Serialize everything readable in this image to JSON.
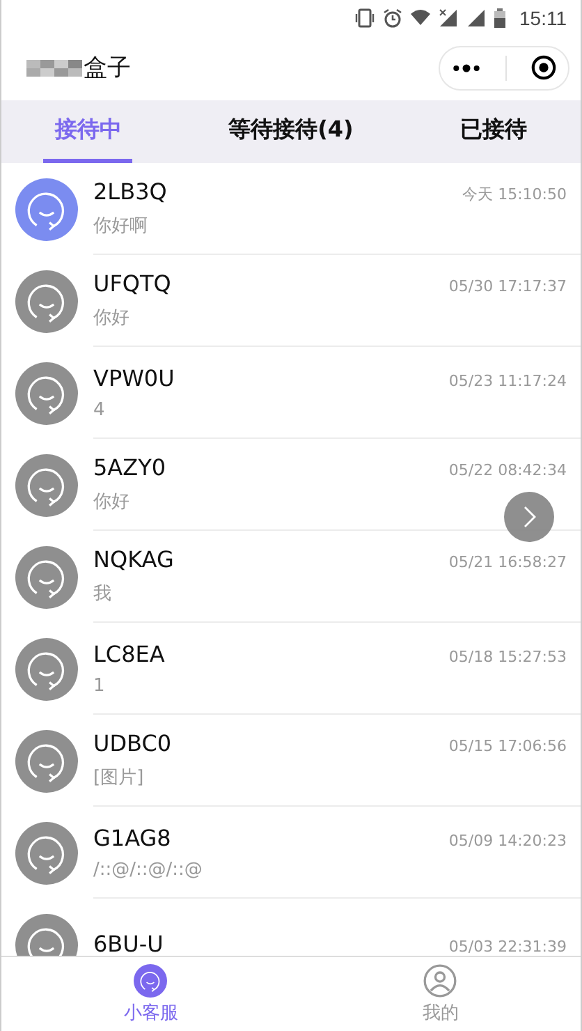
{
  "status_bar": {
    "time": "15:11"
  },
  "header": {
    "title": "盒子"
  },
  "tabs": [
    {
      "label": "接待中",
      "selected": true
    },
    {
      "label": "等待接待(4)",
      "selected": false
    },
    {
      "label": "已接待",
      "selected": false
    }
  ],
  "conversations": [
    {
      "name": "2LB3Q",
      "message": "你好啊",
      "time": "今天 15:10:50",
      "selected": true
    },
    {
      "name": "UFQTQ",
      "message": "你好",
      "time": "05/30 17:17:37",
      "selected": false
    },
    {
      "name": "VPW0U",
      "message": "4",
      "time": "05/23 11:17:24",
      "selected": false
    },
    {
      "name": "5AZY0",
      "message": "你好",
      "time": "05/22 08:42:34",
      "selected": false
    },
    {
      "name": "NQKAG",
      "message": "我",
      "time": "05/21 16:58:27",
      "selected": false
    },
    {
      "name": "LC8EA",
      "message": "1",
      "time": "05/18 15:27:53",
      "selected": false
    },
    {
      "name": "UDBC0",
      "message": "[图片]",
      "time": "05/15 17:06:56",
      "selected": false
    },
    {
      "name": "G1AG8",
      "message": "/::@/::@/::@",
      "time": "05/09 14:20:23",
      "selected": false
    },
    {
      "name": "6BU-U",
      "time": "05/03 22:31:39",
      "selected": false
    }
  ],
  "bottom_tabs": [
    {
      "label": "小客服",
      "selected": true
    },
    {
      "label": "我的",
      "selected": false
    }
  ]
}
